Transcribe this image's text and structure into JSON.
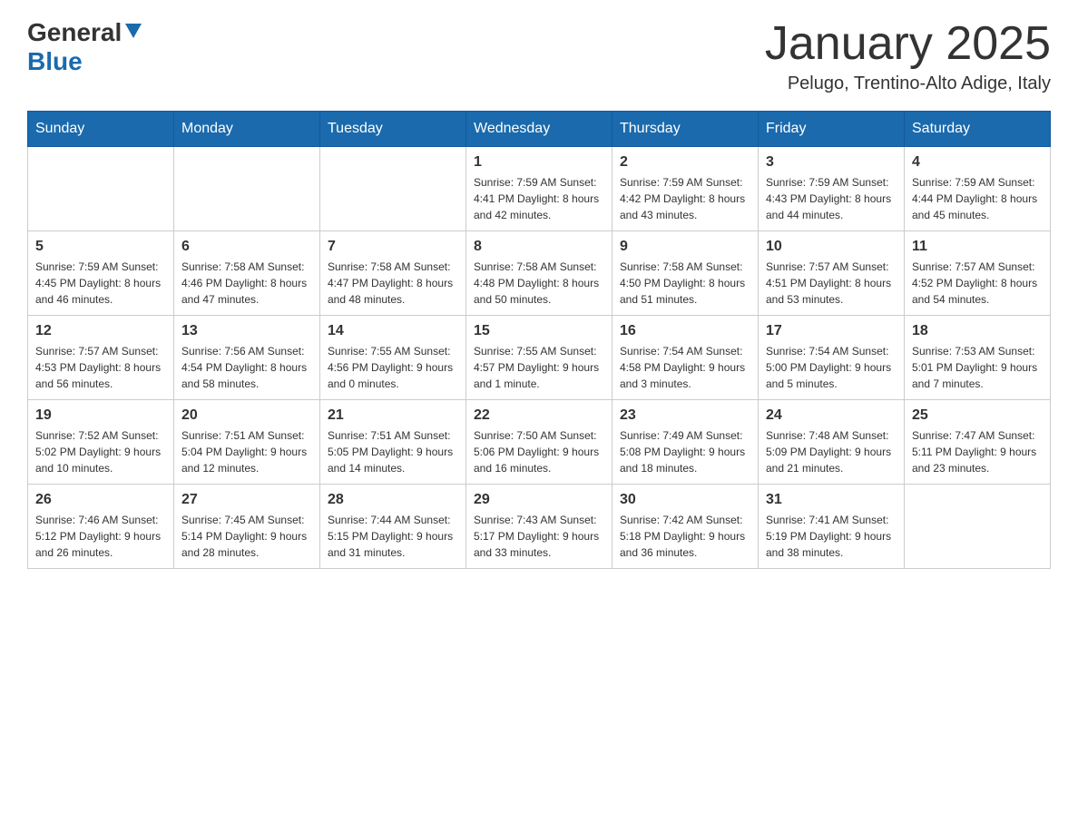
{
  "header": {
    "logo": {
      "general": "General",
      "blue": "Blue"
    },
    "title": "January 2025",
    "subtitle": "Pelugo, Trentino-Alto Adige, Italy"
  },
  "calendar": {
    "days_of_week": [
      "Sunday",
      "Monday",
      "Tuesday",
      "Wednesday",
      "Thursday",
      "Friday",
      "Saturday"
    ],
    "weeks": [
      [
        {
          "day": "",
          "info": ""
        },
        {
          "day": "",
          "info": ""
        },
        {
          "day": "",
          "info": ""
        },
        {
          "day": "1",
          "info": "Sunrise: 7:59 AM\nSunset: 4:41 PM\nDaylight: 8 hours\nand 42 minutes."
        },
        {
          "day": "2",
          "info": "Sunrise: 7:59 AM\nSunset: 4:42 PM\nDaylight: 8 hours\nand 43 minutes."
        },
        {
          "day": "3",
          "info": "Sunrise: 7:59 AM\nSunset: 4:43 PM\nDaylight: 8 hours\nand 44 minutes."
        },
        {
          "day": "4",
          "info": "Sunrise: 7:59 AM\nSunset: 4:44 PM\nDaylight: 8 hours\nand 45 minutes."
        }
      ],
      [
        {
          "day": "5",
          "info": "Sunrise: 7:59 AM\nSunset: 4:45 PM\nDaylight: 8 hours\nand 46 minutes."
        },
        {
          "day": "6",
          "info": "Sunrise: 7:58 AM\nSunset: 4:46 PM\nDaylight: 8 hours\nand 47 minutes."
        },
        {
          "day": "7",
          "info": "Sunrise: 7:58 AM\nSunset: 4:47 PM\nDaylight: 8 hours\nand 48 minutes."
        },
        {
          "day": "8",
          "info": "Sunrise: 7:58 AM\nSunset: 4:48 PM\nDaylight: 8 hours\nand 50 minutes."
        },
        {
          "day": "9",
          "info": "Sunrise: 7:58 AM\nSunset: 4:50 PM\nDaylight: 8 hours\nand 51 minutes."
        },
        {
          "day": "10",
          "info": "Sunrise: 7:57 AM\nSunset: 4:51 PM\nDaylight: 8 hours\nand 53 minutes."
        },
        {
          "day": "11",
          "info": "Sunrise: 7:57 AM\nSunset: 4:52 PM\nDaylight: 8 hours\nand 54 minutes."
        }
      ],
      [
        {
          "day": "12",
          "info": "Sunrise: 7:57 AM\nSunset: 4:53 PM\nDaylight: 8 hours\nand 56 minutes."
        },
        {
          "day": "13",
          "info": "Sunrise: 7:56 AM\nSunset: 4:54 PM\nDaylight: 8 hours\nand 58 minutes."
        },
        {
          "day": "14",
          "info": "Sunrise: 7:55 AM\nSunset: 4:56 PM\nDaylight: 9 hours\nand 0 minutes."
        },
        {
          "day": "15",
          "info": "Sunrise: 7:55 AM\nSunset: 4:57 PM\nDaylight: 9 hours\nand 1 minute."
        },
        {
          "day": "16",
          "info": "Sunrise: 7:54 AM\nSunset: 4:58 PM\nDaylight: 9 hours\nand 3 minutes."
        },
        {
          "day": "17",
          "info": "Sunrise: 7:54 AM\nSunset: 5:00 PM\nDaylight: 9 hours\nand 5 minutes."
        },
        {
          "day": "18",
          "info": "Sunrise: 7:53 AM\nSunset: 5:01 PM\nDaylight: 9 hours\nand 7 minutes."
        }
      ],
      [
        {
          "day": "19",
          "info": "Sunrise: 7:52 AM\nSunset: 5:02 PM\nDaylight: 9 hours\nand 10 minutes."
        },
        {
          "day": "20",
          "info": "Sunrise: 7:51 AM\nSunset: 5:04 PM\nDaylight: 9 hours\nand 12 minutes."
        },
        {
          "day": "21",
          "info": "Sunrise: 7:51 AM\nSunset: 5:05 PM\nDaylight: 9 hours\nand 14 minutes."
        },
        {
          "day": "22",
          "info": "Sunrise: 7:50 AM\nSunset: 5:06 PM\nDaylight: 9 hours\nand 16 minutes."
        },
        {
          "day": "23",
          "info": "Sunrise: 7:49 AM\nSunset: 5:08 PM\nDaylight: 9 hours\nand 18 minutes."
        },
        {
          "day": "24",
          "info": "Sunrise: 7:48 AM\nSunset: 5:09 PM\nDaylight: 9 hours\nand 21 minutes."
        },
        {
          "day": "25",
          "info": "Sunrise: 7:47 AM\nSunset: 5:11 PM\nDaylight: 9 hours\nand 23 minutes."
        }
      ],
      [
        {
          "day": "26",
          "info": "Sunrise: 7:46 AM\nSunset: 5:12 PM\nDaylight: 9 hours\nand 26 minutes."
        },
        {
          "day": "27",
          "info": "Sunrise: 7:45 AM\nSunset: 5:14 PM\nDaylight: 9 hours\nand 28 minutes."
        },
        {
          "day": "28",
          "info": "Sunrise: 7:44 AM\nSunset: 5:15 PM\nDaylight: 9 hours\nand 31 minutes."
        },
        {
          "day": "29",
          "info": "Sunrise: 7:43 AM\nSunset: 5:17 PM\nDaylight: 9 hours\nand 33 minutes."
        },
        {
          "day": "30",
          "info": "Sunrise: 7:42 AM\nSunset: 5:18 PM\nDaylight: 9 hours\nand 36 minutes."
        },
        {
          "day": "31",
          "info": "Sunrise: 7:41 AM\nSunset: 5:19 PM\nDaylight: 9 hours\nand 38 minutes."
        },
        {
          "day": "",
          "info": ""
        }
      ]
    ]
  }
}
